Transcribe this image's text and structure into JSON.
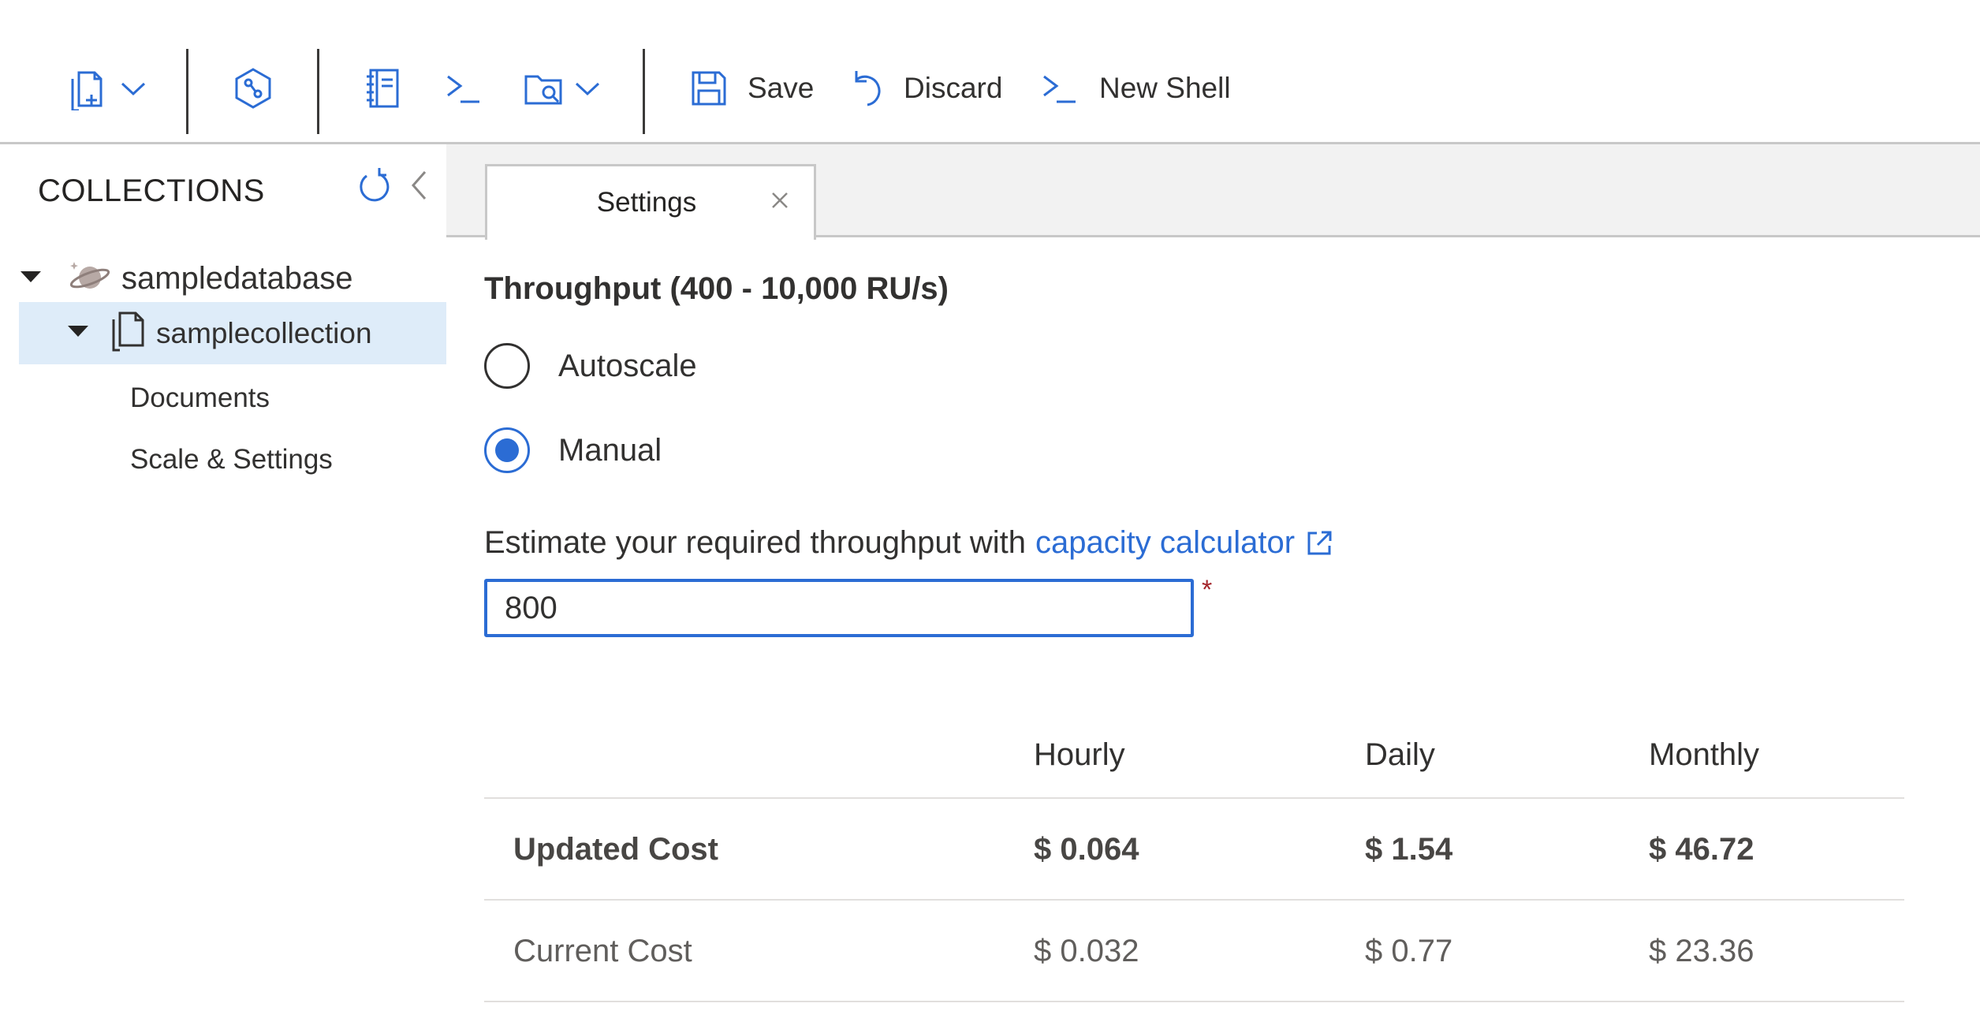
{
  "toolbar": {
    "new_collection_icon": "new-collection-icon",
    "dropdown_icon": "chevron-down-icon",
    "synapse_icon": "synapse-link-icon",
    "notebook_icon": "notebook-icon",
    "shell_icon": "shell-prompt-icon",
    "open_query_icon": "folder-search-icon",
    "save_label": "Save",
    "discard_label": "Discard",
    "new_shell_label": "New Shell",
    "accent_color": "#2b6cd4"
  },
  "sidebar": {
    "header": "COLLECTIONS",
    "refresh_icon": "refresh-icon",
    "collapse_icon": "chevron-left-icon",
    "database": {
      "label": "sampledatabase",
      "icon": "planet-icon",
      "expanded": true
    },
    "collection": {
      "label": "samplecollection",
      "icon": "collection-icon",
      "expanded": true,
      "selected": true
    },
    "children": [
      {
        "label": "Documents"
      },
      {
        "label": "Scale & Settings"
      }
    ]
  },
  "tabs": [
    {
      "label": "Settings",
      "active": true,
      "close_icon": "close-icon"
    }
  ],
  "settings": {
    "throughput_title": "Throughput (400 - 10,000 RU/s)",
    "options": [
      {
        "label": "Autoscale",
        "checked": false
      },
      {
        "label": "Manual",
        "checked": true
      }
    ],
    "estimate_text": "Estimate your required throughput with",
    "calculator_link": "capacity calculator",
    "throughput_value": "800",
    "required_marker": "*",
    "cost_table": {
      "headers": [
        "",
        "Hourly",
        "Daily",
        "Monthly"
      ],
      "rows": [
        {
          "label": "Updated Cost",
          "hourly": "$ 0.064",
          "daily": "$ 1.54",
          "monthly": "$ 46.72"
        },
        {
          "label": "Current Cost",
          "hourly": "$ 0.032",
          "daily": "$ 0.77",
          "monthly": "$ 23.36"
        }
      ]
    }
  }
}
